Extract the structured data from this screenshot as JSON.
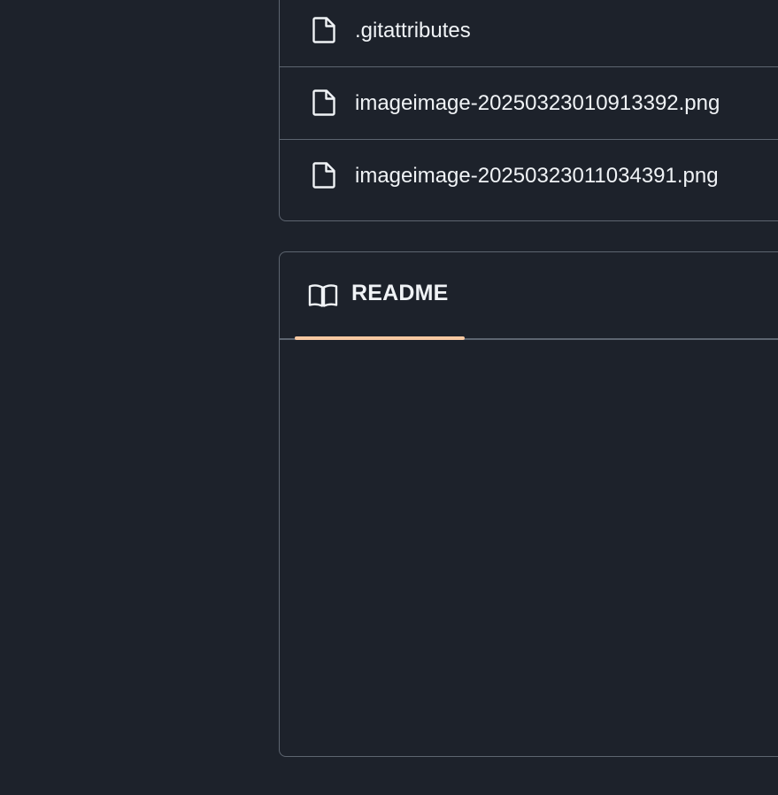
{
  "files": [
    {
      "name": ".gitattributes",
      "icon": "file-icon"
    },
    {
      "name": "imageimage-20250323010913392.png",
      "icon": "file-icon"
    },
    {
      "name": "imageimage-20250323011034391.png",
      "icon": "file-icon"
    }
  ],
  "readme": {
    "tab_label": "README",
    "tab_icon": "book-icon",
    "accent_color": "#f7c8a1"
  },
  "colors": {
    "background": "#1d222b",
    "border": "#5d6570",
    "text": "#f0f3f6"
  }
}
